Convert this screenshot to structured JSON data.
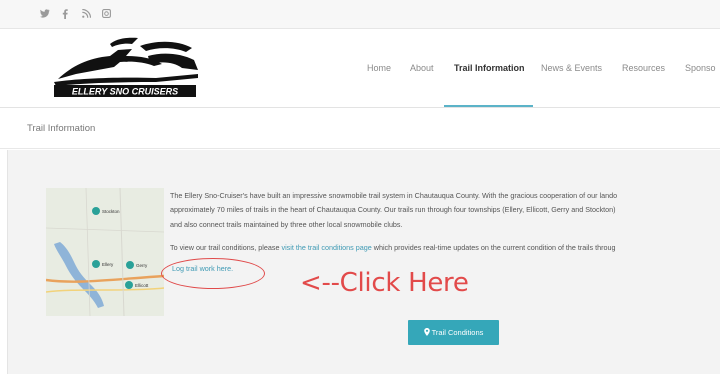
{
  "social": {
    "icons": [
      {
        "name": "twitter-icon",
        "glyph": "𝕪"
      },
      {
        "name": "facebook-icon",
        "glyph": "f"
      },
      {
        "name": "rss-icon",
        "glyph": "ℷ"
      },
      {
        "name": "instagram-icon",
        "glyph": "◙"
      }
    ]
  },
  "header": {
    "logo_text": "ELLERY SNO CRUISERS",
    "nav": [
      "Home",
      "About",
      "Trail Information",
      "News & Events",
      "Resources",
      "Sponso"
    ],
    "active_nav": "Trail Information"
  },
  "page": {
    "title": "Trail Information"
  },
  "content": {
    "para1_line1": "The Ellery Sno-Cruiser's have built an impressive snowmobile trail system in Chautauqua County. With the gracious cooperation of our lando",
    "para1_line2": "approximately 70 miles of trails in the heart of Chautauqua County. Our trails run through four townships (Ellery, Ellicott, Gerry and Stockton)",
    "para1_line3": "and also connect trails maintained by three other local snowmobile clubs.",
    "para2_prefix": "To view our trail conditions, please ",
    "para2_link": "visit the trail conditions page",
    "para2_suffix": " which provides real-time updates on the current condition of the trails throug",
    "log_trail_link": "Log trail work here.",
    "annotation": "<--Click Here",
    "button_label": "Trail Conditions",
    "map_labels": {
      "stockton": "Stockton",
      "ellery": "Ellery",
      "gerry": "Gerry",
      "ellicott": "Ellicott"
    }
  },
  "colors": {
    "accent": "#35a7b9",
    "annotation_red": "#e24a4a",
    "link": "#3f9ab4"
  }
}
